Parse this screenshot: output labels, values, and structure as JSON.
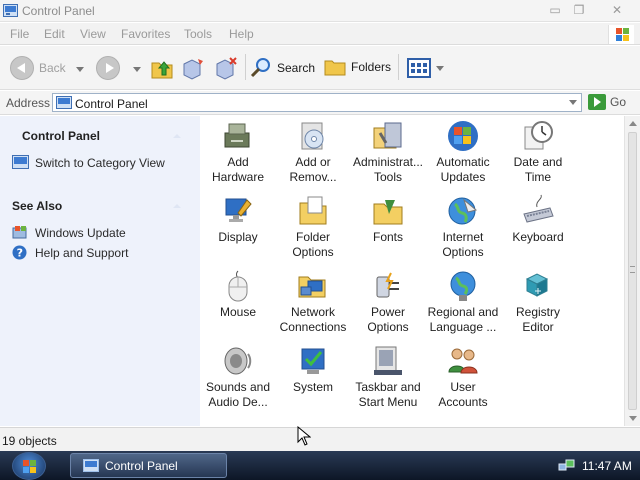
{
  "window": {
    "title": "Control Panel"
  },
  "menu": [
    "File",
    "Edit",
    "View",
    "Favorites",
    "Tools",
    "Help"
  ],
  "toolbar": {
    "back_label": "Back",
    "search_label": "Search",
    "folders_label": "Folders"
  },
  "address": {
    "label": "Address",
    "value": "Control Panel",
    "go_label": "Go"
  },
  "taskpane": {
    "control_panel_heading": "Control Panel",
    "switch_view": "Switch to Category View",
    "see_also_heading": "See Also",
    "links": [
      "Windows Update",
      "Help and Support"
    ]
  },
  "items": [
    {
      "label": "Add Hardware",
      "icon": "hardware-icon"
    },
    {
      "label": "Add or Remov...",
      "icon": "add-remove-programs-icon"
    },
    {
      "label": "Administrat... Tools",
      "icon": "admin-tools-icon"
    },
    {
      "label": "Automatic Updates",
      "icon": "windows-flag-icon"
    },
    {
      "label": "Date and Time",
      "icon": "clock-icon"
    },
    {
      "label": "Display",
      "icon": "display-icon"
    },
    {
      "label": "Folder Options",
      "icon": "folder-options-icon"
    },
    {
      "label": "Fonts",
      "icon": "fonts-folder-icon"
    },
    {
      "label": "Internet Options",
      "icon": "globe-icon"
    },
    {
      "label": "Keyboard",
      "icon": "keyboard-icon"
    },
    {
      "label": "Mouse",
      "icon": "mouse-icon"
    },
    {
      "label": "Network Connections",
      "icon": "network-icon"
    },
    {
      "label": "Power Options",
      "icon": "power-icon"
    },
    {
      "label": "Regional and Language ...",
      "icon": "regional-globe-icon"
    },
    {
      "label": "Registry Editor",
      "icon": "registry-icon"
    },
    {
      "label": "Sounds and Audio De...",
      "icon": "speaker-icon"
    },
    {
      "label": "System",
      "icon": "system-icon"
    },
    {
      "label": "Taskbar and Start Menu",
      "icon": "taskbar-icon"
    },
    {
      "label": "User Accounts",
      "icon": "users-icon"
    }
  ],
  "status": {
    "text": "19 objects"
  },
  "taskbar": {
    "task_label": "Control Panel",
    "clock": "11:47 AM"
  }
}
